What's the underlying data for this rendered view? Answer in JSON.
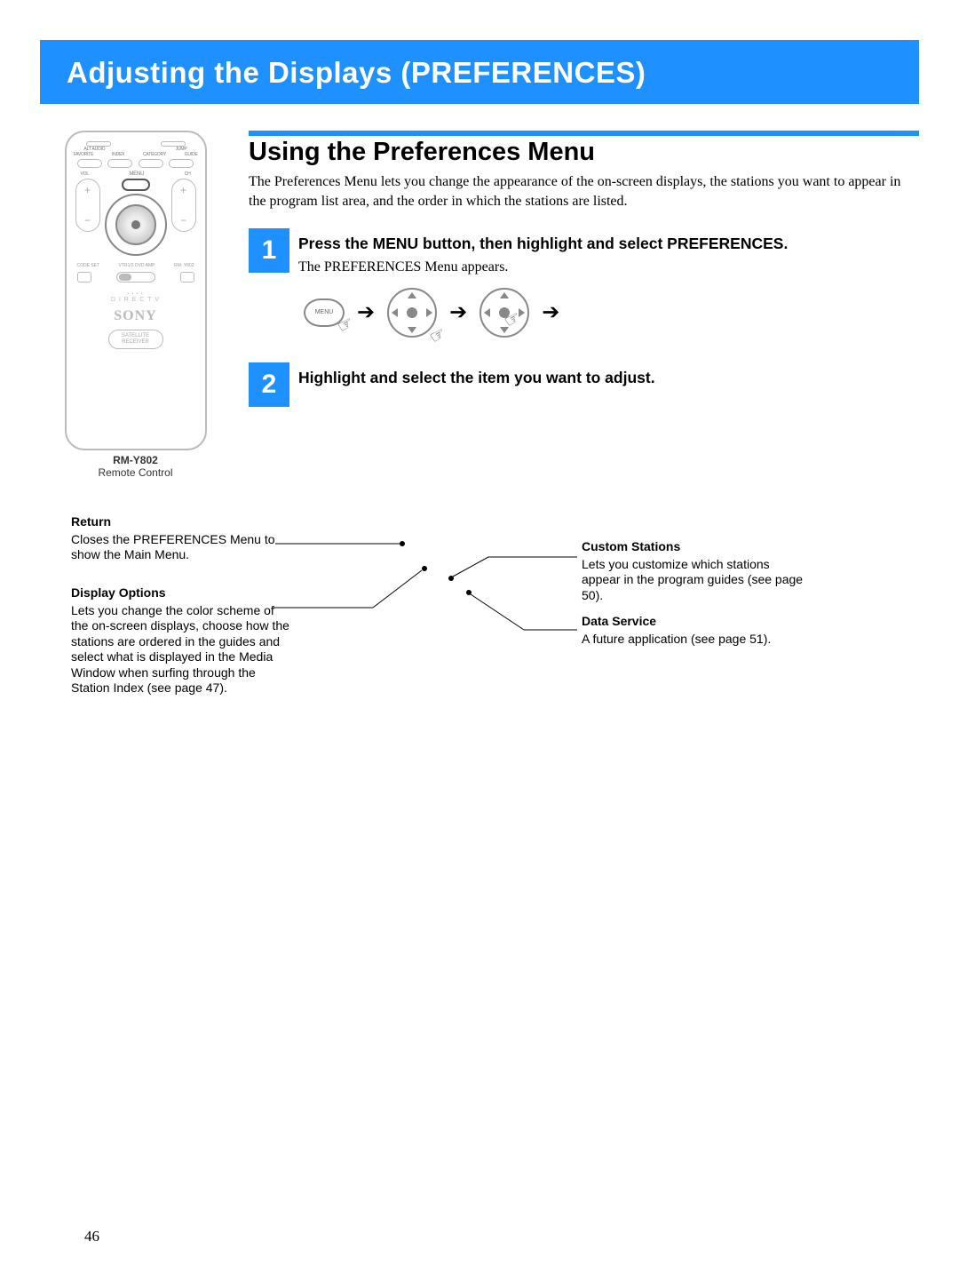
{
  "header_title": "Adjusting the Displays (PREFERENCES)",
  "section_title": "Using the Preferences Menu",
  "section_desc": "The Preferences Menu lets you change the appearance of the on-screen displays, the stations you want to appear in the program list area, and the order in which the stations are listed.",
  "steps": [
    {
      "num": "1",
      "heading": "Press the MENU button, then highlight and select PREFERENCES.",
      "sub": "The PREFERENCES Menu appears."
    },
    {
      "num": "2",
      "heading": "Highlight and select the item you want to adjust.",
      "sub": ""
    }
  ],
  "menu_label": "MENU",
  "remote": {
    "model": "RM-Y802",
    "sub": "Remote Control",
    "top_labels": [
      "ALT AUDIO",
      "JUMP"
    ],
    "row4_labels": [
      "FAVORITE",
      "INDEX",
      "CATEGORY",
      "GUIDE"
    ],
    "vol": "VOL",
    "ch": "CH",
    "menu": "MENU",
    "switch_labels": [
      "CODE SET",
      "VTR1/2 DVD AMP",
      "RM- Y802"
    ],
    "directv": "D I R E C T V",
    "sony": "SONY",
    "sat": "SATELLITE RECEIVER"
  },
  "callouts": {
    "return": {
      "title": "Return",
      "body": "Closes the PREFERENCES Menu to show the Main Menu."
    },
    "display_options": {
      "title": "Display Options",
      "body": "Lets you change the color scheme of the on-screen displays, choose how the stations are ordered in the guides and select what is displayed in the Media Window when surfing through the Station Index (see page 47)."
    },
    "custom_stations": {
      "title": "Custom Stations",
      "body": "Lets you customize which stations appear in the program guides (see page 50)."
    },
    "data_service": {
      "title": "Data Service",
      "body": "A future application (see page 51)."
    }
  },
  "page_number": "46"
}
